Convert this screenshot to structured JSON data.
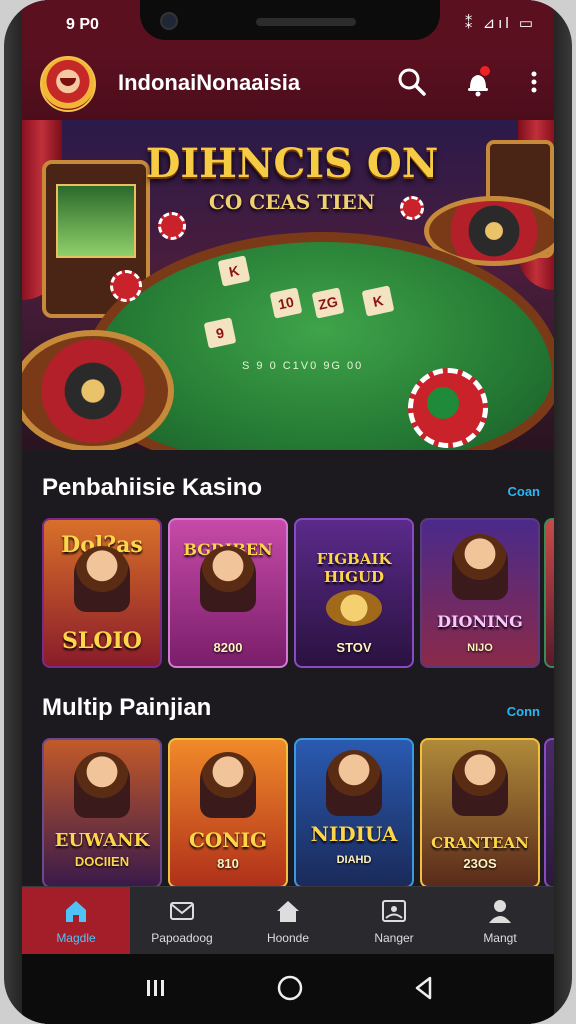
{
  "status": {
    "time": "9 P0",
    "icons": "⁑ ⊿ıl ▭"
  },
  "app": {
    "title": "IndonaiNonaaisia"
  },
  "hero": {
    "title": "DIHNCIS ON",
    "subtitle": "CO CEAS TIEN",
    "table_text": "S 9 0 C1V0 9G 00",
    "cards": [
      "K",
      "10",
      "ZG",
      "K",
      "9"
    ]
  },
  "section1": {
    "title": "Penbahiisie Kasino",
    "link": "Coan",
    "tiles": [
      {
        "top": "Dol?as",
        "bottom": "SLOIO"
      },
      {
        "top": "BGDIBEN",
        "bottom": "8200"
      },
      {
        "top": "FIGBAIK HIGUD",
        "bottom": "STOV"
      },
      {
        "top": "DIONING",
        "bottom": "NIJO"
      }
    ]
  },
  "section2": {
    "title": "Multip Painjian",
    "link": "Conn",
    "tiles": [
      {
        "top": "EUWANK",
        "bottom": "DOCIIEN"
      },
      {
        "top": "CONIG",
        "bottom": "810"
      },
      {
        "top": "NIDIUA",
        "bottom": "DIAHD"
      },
      {
        "top": "CRANTEAN",
        "bottom": "23OS"
      }
    ]
  },
  "nav": {
    "items": [
      {
        "label": "Magdle",
        "icon": "home-icon"
      },
      {
        "label": "Papoadoog",
        "icon": "mail-icon"
      },
      {
        "label": "Hoonde",
        "icon": "house-icon"
      },
      {
        "label": "Nanger",
        "icon": "picture-icon"
      },
      {
        "label": "Mangt",
        "icon": "person-icon"
      }
    ]
  },
  "colors": {
    "accent": "#a41e2a",
    "bar": "#5b1020",
    "link": "#29b6f6"
  }
}
